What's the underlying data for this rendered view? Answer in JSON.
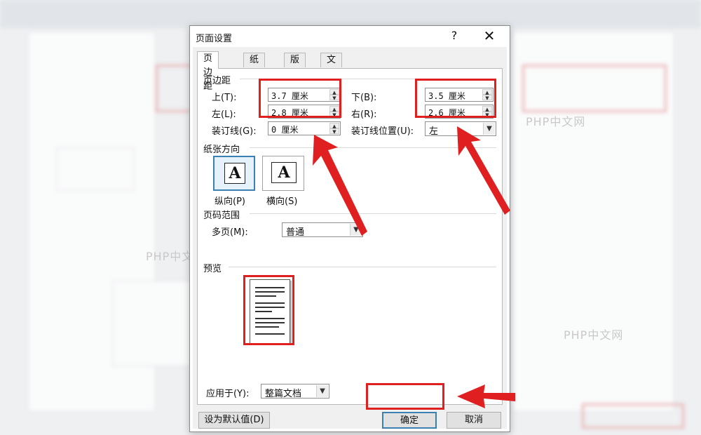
{
  "dialog": {
    "title": "页面设置",
    "help": "?",
    "close": "✕",
    "tabs": [
      "页边距",
      "纸张",
      "版式",
      "文档网格"
    ],
    "margins": {
      "group_label": "页边距",
      "top_label": "上(T):",
      "top_value": "3.7 厘米",
      "bottom_label": "下(B):",
      "bottom_value": "3.5 厘米",
      "left_label": "左(L):",
      "left_value": "2.8 厘米",
      "right_label": "右(R):",
      "right_value": "2.6 厘米",
      "gutter_label": "装订线(G):",
      "gutter_value": "0 厘米",
      "gutter_pos_label": "装订线位置(U):",
      "gutter_pos_value": "左"
    },
    "orientation": {
      "group_label": "纸张方向",
      "portrait_label": "纵向(P)",
      "landscape_label": "横向(S)",
      "icon_letter": "A"
    },
    "pages": {
      "group_label": "页码范围",
      "multiple_label": "多页(M):",
      "multiple_value": "普通"
    },
    "preview": {
      "group_label": "预览",
      "apply_label": "应用于(Y):",
      "apply_value": "整篇文档"
    },
    "buttons": {
      "set_default": "设为默认值(D)",
      "ok": "确定",
      "cancel": "取消"
    }
  },
  "watermarks": [
    "PHP中文网",
    "PHP中文网",
    "PHP中文网",
    "PHP中文网"
  ],
  "colors": {
    "highlight": "#e02020",
    "accent": "#3c7fb1"
  }
}
